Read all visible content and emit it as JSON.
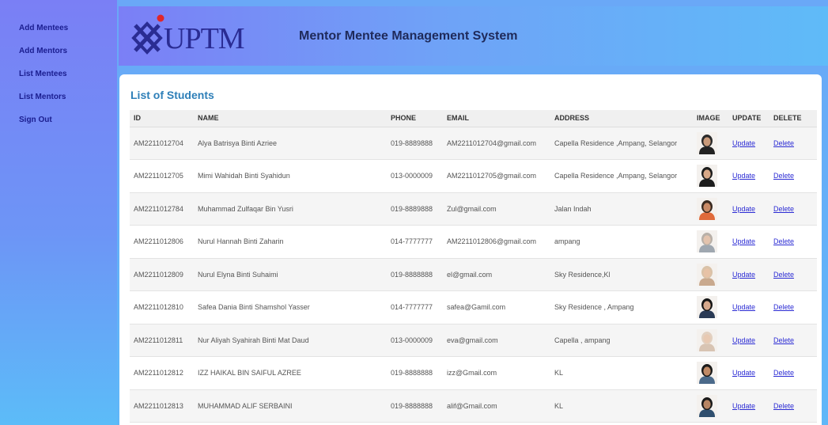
{
  "sidebar": {
    "items": [
      {
        "label": "Add Mentees"
      },
      {
        "label": "Add Mentors"
      },
      {
        "label": "List Mentees"
      },
      {
        "label": "List Mentors"
      },
      {
        "label": "Sign Out"
      }
    ]
  },
  "header": {
    "logo_text": "UPTM",
    "title": "Mentor Mentee Management System"
  },
  "main": {
    "heading": "List of Students",
    "columns": [
      "ID",
      "NAME",
      "PHONE",
      "EMAIL",
      "ADDRESS",
      "IMAGE",
      "UPDATE",
      "DELETE"
    ],
    "rows": [
      {
        "id": "AM2211012704",
        "name": "Alya Batrisya Binti Azriee",
        "phone": "019-8889888",
        "email": "AM2211012704@gmail.com",
        "address": "Capella Residence ,Ampang, Selangor",
        "update": "Update",
        "delete": "Delete",
        "avatar": {
          "skin": "#c99a7a",
          "hair": "#2a2a2a",
          "cloth": "#222"
        }
      },
      {
        "id": "AM2211012705",
        "name": "Mimi Wahidah Binti Syahidun",
        "phone": "013-0000009",
        "email": "AM2211012705@gmail.com",
        "address": "Capella Residence ,Ampang, Selangor",
        "update": "Update",
        "delete": "Delete",
        "avatar": {
          "skin": "#d9a988",
          "hair": "#1d1d1d",
          "cloth": "#1d1d1d"
        }
      },
      {
        "id": "AM2211012784",
        "name": "Muhammad Zulfaqar Bin Yusri",
        "phone": "019-8889888",
        "email": "Zul@gmail.com",
        "address": "Jalan Indah",
        "update": "Update",
        "delete": "Delete",
        "avatar": {
          "skin": "#c98a66",
          "hair": "#3a2a20",
          "cloth": "#e06a3a"
        }
      },
      {
        "id": "AM2211012806",
        "name": "Nurul Hannah Binti Zaharin",
        "phone": "014-7777777",
        "email": "AM2211012806@gmail.com",
        "address": "ampang",
        "update": "Update",
        "delete": "Delete",
        "avatar": {
          "skin": "#e3c3ad",
          "hair": "#b8b0a8",
          "cloth": "#9fa7b0"
        }
      },
      {
        "id": "AM2211012809",
        "name": "Nurul Elyna Binti Suhaimi",
        "phone": "019-8888888",
        "email": "el@gmail.com",
        "address": "Sky Residence,Kl",
        "update": "Update",
        "delete": "Delete",
        "avatar": {
          "skin": "#e7c2a6",
          "hair": "#d9c2a8",
          "cloth": "#c9a98e"
        }
      },
      {
        "id": "AM2211012810",
        "name": "Safea Dania Binti Shamshol Yasser",
        "phone": "014-7777777",
        "email": "safea@Gamil.com",
        "address": "Sky Residence , Ampang",
        "update": "Update",
        "delete": "Delete",
        "avatar": {
          "skin": "#d7a98c",
          "hair": "#161616",
          "cloth": "#2a3a55"
        }
      },
      {
        "id": "AM2211012811",
        "name": "Nur Aliyah Syahirah Binti Mat Daud",
        "phone": "013-0000009",
        "email": "eva@gmail.com",
        "address": "Capella , ampang",
        "update": "Update",
        "delete": "Delete",
        "avatar": {
          "skin": "#e8c9b2",
          "hair": "#e2d0c0",
          "cloth": "#d8c4b3"
        }
      },
      {
        "id": "AM2211012812",
        "name": "IZZ HAIKAL BIN SAIFUL AZREE",
        "phone": "019-8888888",
        "email": "izz@Gmail.com",
        "address": "KL",
        "update": "Update",
        "delete": "Delete",
        "avatar": {
          "skin": "#c08a66",
          "hair": "#1a1a1a",
          "cloth": "#4b6a8a"
        }
      },
      {
        "id": "AM2211012813",
        "name": "MUHAMMAD ALIF SERBAINI",
        "phone": "019-8888888",
        "email": "alif@Gmail.com",
        "address": "KL",
        "update": "Update",
        "delete": "Delete",
        "avatar": {
          "skin": "#b88563",
          "hair": "#1a1a1a",
          "cloth": "#2f4f6f"
        }
      }
    ]
  }
}
